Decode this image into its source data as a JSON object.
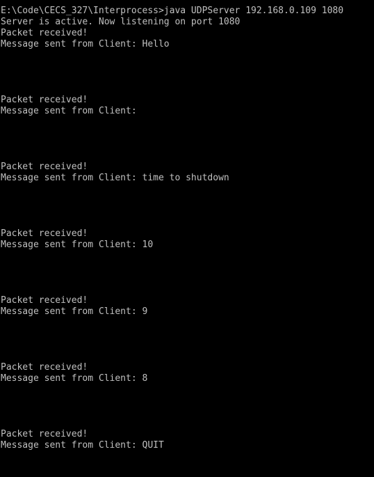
{
  "console": {
    "text_color": "#c0c0c0",
    "background": "#000000",
    "lines": [
      "E:\\Code\\CECS_327\\Interprocess>java UDPServer 192.168.0.109 1080",
      "Server is active. Now listening on port 1080",
      "Packet received!",
      "Message sent from Client: Hello",
      "",
      "",
      "",
      "",
      "Packet received!",
      "Message sent from Client:",
      "",
      "",
      "",
      "",
      "Packet received!",
      "Message sent from Client: time to shutdown",
      "",
      "",
      "",
      "",
      "Packet received!",
      "Message sent from Client: 10",
      "",
      "",
      "",
      "",
      "Packet received!",
      "Message sent from Client: 9",
      "",
      "",
      "",
      "",
      "Packet received!",
      "Message sent from Client: 8",
      "",
      "",
      "",
      "",
      "Packet received!",
      "Message sent from Client: QUIT"
    ]
  }
}
